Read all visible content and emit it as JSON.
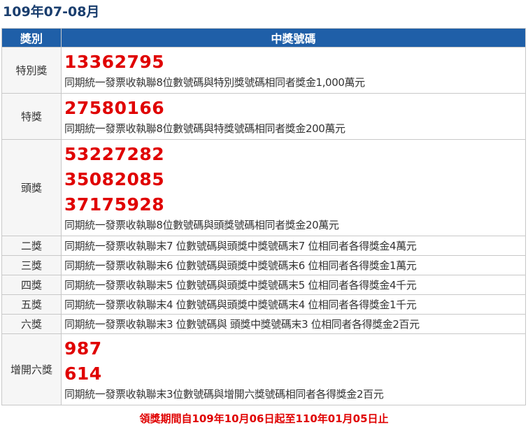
{
  "period_title": "109年07-08月",
  "table": {
    "headers": {
      "category": "獎別",
      "numbers": "中獎號碼"
    },
    "rows": [
      {
        "category": "特別獎",
        "numbers": [
          "13362795"
        ],
        "description": "同期統一發票收執聯8位數號碼與特別獎號碼相同者獎金1,000萬元"
      },
      {
        "category": "特獎",
        "numbers": [
          "27580166"
        ],
        "description": "同期統一發票收執聯8位數號碼與特獎號碼相同者獎金200萬元"
      },
      {
        "category": "頭獎",
        "numbers": [
          "53227282",
          "35082085",
          "37175928"
        ],
        "description": "同期統一發票收執聯8位數號碼與頭獎號碼相同者獎金20萬元"
      },
      {
        "category": "二獎",
        "numbers": [],
        "description": "同期統一發票收執聯末7 位數號碼與頭獎中獎號碼末7 位相同者各得獎金4萬元"
      },
      {
        "category": "三獎",
        "numbers": [],
        "description": "同期統一發票收執聯末6 位數號碼與頭獎中獎號碼末6 位相同者各得獎金1萬元"
      },
      {
        "category": "四獎",
        "numbers": [],
        "description": "同期統一發票收執聯末5 位數號碼與頭獎中獎號碼末5 位相同者各得獎金4千元"
      },
      {
        "category": "五獎",
        "numbers": [],
        "description": "同期統一發票收執聯末4 位數號碼與頭獎中獎號碼末4 位相同者各得獎金1千元"
      },
      {
        "category": "六獎",
        "numbers": [],
        "description": "同期統一發票收執聯末3 位數號碼與 頭獎中獎號碼末3 位相同者各得獎金2百元"
      },
      {
        "category": "增開六獎",
        "numbers": [
          "987",
          "614"
        ],
        "description": "同期統一發票收執聯末3位數號碼與增開六獎號碼相同者各得獎金2百元"
      }
    ]
  },
  "claim_note": "領獎期間自109年10月06日起至110年01月05日止",
  "colors": {
    "header_bg": "#1f5fa8",
    "title": "#1a3e6e",
    "winning_number": "#e00000",
    "category_bg": "#f6f6f6"
  }
}
